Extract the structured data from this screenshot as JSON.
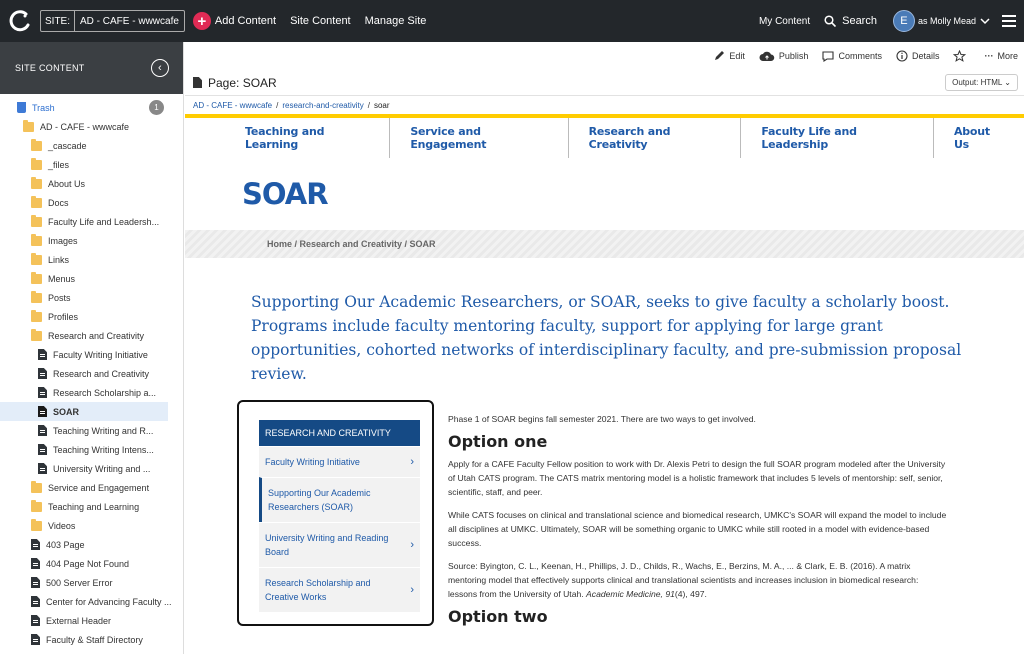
{
  "topbar": {
    "site_label": "SITE:",
    "site_value": "AD - CAFE - wwwcafe",
    "add_content": "Add Content",
    "site_content": "Site Content",
    "manage_site": "Manage Site",
    "my_content": "My Content",
    "search": "Search",
    "user_initial": "E",
    "user_label": "as Molly Mead"
  },
  "sidebar": {
    "title": "SITE CONTENT",
    "trash": "Trash",
    "trash_count": "1",
    "root": "AD - CAFE - wwwcafe",
    "items": [
      {
        "label": "_cascade",
        "type": "folder",
        "depth": 1
      },
      {
        "label": "_files",
        "type": "folder",
        "depth": 1
      },
      {
        "label": "About Us",
        "type": "folder",
        "depth": 1
      },
      {
        "label": "Docs",
        "type": "folder",
        "depth": 1
      },
      {
        "label": "Faculty Life and Leadersh...",
        "type": "folder",
        "depth": 1
      },
      {
        "label": "Images",
        "type": "folder",
        "depth": 1
      },
      {
        "label": "Links",
        "type": "folder",
        "depth": 1
      },
      {
        "label": "Menus",
        "type": "folder",
        "depth": 1
      },
      {
        "label": "Posts",
        "type": "folder",
        "depth": 1
      },
      {
        "label": "Profiles",
        "type": "folder",
        "depth": 1
      },
      {
        "label": "Research and Creativity",
        "type": "folder",
        "depth": 1
      },
      {
        "label": "Faculty Writing Initiative",
        "type": "page",
        "depth": 2
      },
      {
        "label": "Research and Creativity",
        "type": "page",
        "depth": 2
      },
      {
        "label": "Research Scholarship a...",
        "type": "page",
        "depth": 2
      },
      {
        "label": "SOAR",
        "type": "page",
        "depth": 2,
        "selected": true
      },
      {
        "label": "Teaching Writing and R...",
        "type": "page",
        "depth": 2
      },
      {
        "label": "Teaching Writing Intens...",
        "type": "page",
        "depth": 2
      },
      {
        "label": "University Writing and ...",
        "type": "page",
        "depth": 2
      },
      {
        "label": "Service and Engagement",
        "type": "folder",
        "depth": 1
      },
      {
        "label": "Teaching and Learning",
        "type": "folder",
        "depth": 1
      },
      {
        "label": "Videos",
        "type": "folder",
        "depth": 1
      },
      {
        "label": "403 Page",
        "type": "page",
        "depth": 1
      },
      {
        "label": "404 Page Not Found",
        "type": "page",
        "depth": 1
      },
      {
        "label": "500 Server Error",
        "type": "page",
        "depth": 1
      },
      {
        "label": "Center for Advancing Faculty ...",
        "type": "page",
        "depth": 1
      },
      {
        "label": "External Header",
        "type": "page",
        "depth": 1
      },
      {
        "label": "Faculty & Staff Directory",
        "type": "page",
        "depth": 1
      }
    ]
  },
  "actions": {
    "edit": "Edit",
    "publish": "Publish",
    "comments": "Comments",
    "details": "Details",
    "more": "More"
  },
  "page": {
    "title": "Page: SOAR",
    "output": "Output: HTML"
  },
  "crumbs": {
    "root": "AD - CAFE - wwwcafe",
    "folder": "research-and-creativity",
    "current": "soar"
  },
  "preview": {
    "nav": [
      "Teaching and Learning",
      "Service and Engagement",
      "Research and Creativity",
      "Faculty Life and Leadership",
      "About Us"
    ],
    "title": "SOAR",
    "breadcrumb": "Home / Research and Creativity / SOAR",
    "lead": "Supporting Our Academic Researchers, or SOAR, seeks to give faculty a scholarly boost. Programs include faculty mentoring faculty, support for applying for large grant opportunities, cohorted networks of interdisciplinary faculty, and pre-submission proposal review.",
    "sidenav_head": "RESEARCH AND CREATIVITY",
    "sidenav": [
      "Faculty Writing Initiative",
      "Supporting Our Academic Researchers (SOAR)",
      "University Writing and Reading Board",
      "Research Scholarship and Creative Works"
    ],
    "intro": "Phase 1 of SOAR begins fall semester 2021. There are two ways to get involved.",
    "h_option1": "Option one",
    "p1": "Apply for a CAFE Faculty Fellow position to work with Dr. Alexis Petri to design the full SOAR program modeled after the University of Utah CATS program. The CATS matrix mentoring model is a holistic framework that includes 5 levels of mentorship: self, senior, scientific, staff, and peer.",
    "p2": "While CATS focuses on clinical and translational science and biomedical research, UMKC's SOAR will expand the model to include all disciplines at UMKC. Ultimately, SOAR will be something organic to UMKC while still rooted in a model with evidence-based success.",
    "p3_a": "Source: Byington, C. L., Keenan, H., Phillips, J. D., Childs, R., Wachs, E., Berzins, M. A., ... & Clark, E. B. (2016). A matrix mentoring model that effectively supports clinical and translational scientists and increases inclusion in biomedical research: lessons from the University of Utah.",
    "p3_journal": "Academic Medicine, 91",
    "p3_b": "(4), 497.",
    "h_option2": "Option two"
  }
}
